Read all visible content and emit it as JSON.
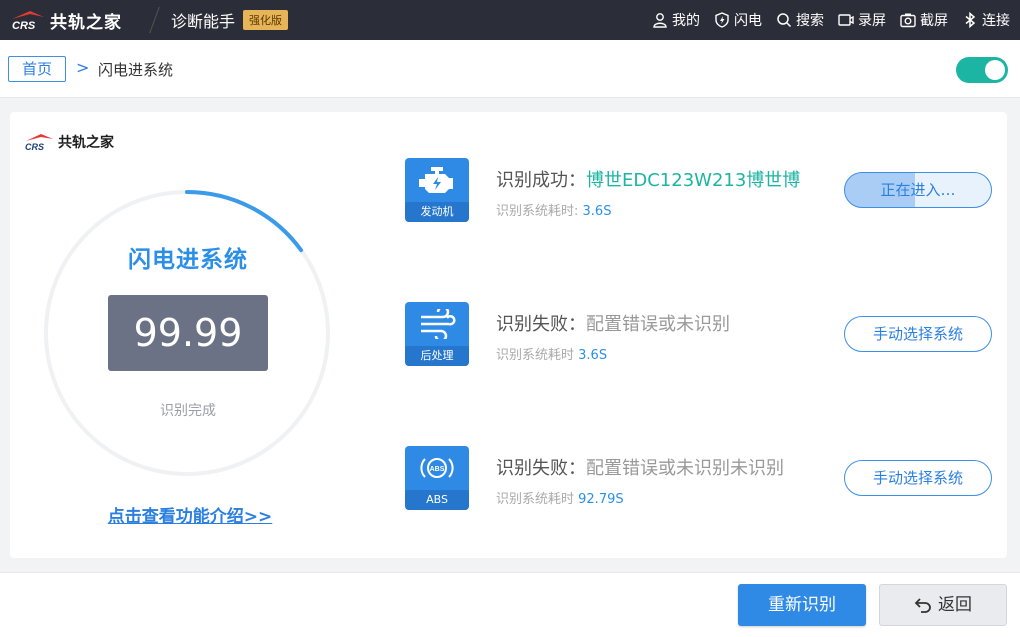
{
  "topbar": {
    "brand_text": "共轨之家",
    "app_title": "诊断能手",
    "badge": "强化版",
    "menu": [
      {
        "label": "我的",
        "icon": "user-icon"
      },
      {
        "label": "闪电",
        "icon": "flash-icon"
      },
      {
        "label": "搜索",
        "icon": "search-icon"
      },
      {
        "label": "录屏",
        "icon": "record-icon"
      },
      {
        "label": "截屏",
        "icon": "screenshot-icon"
      },
      {
        "label": "连接",
        "icon": "bluetooth-icon"
      }
    ]
  },
  "breadcrumb": {
    "home": "首页",
    "separator": ">",
    "current": "闪电进系统"
  },
  "toggle": {
    "on": true,
    "color": "#1cb5a3"
  },
  "card": {
    "logo_text": "共轨之家",
    "title": "闪电进系统",
    "value": "99.99",
    "status": "识别完成",
    "progress_arc_fraction": 0.15,
    "intro_link": "点击查看功能介绍>>"
  },
  "systems": [
    {
      "icon": "engine-icon",
      "caption": "发动机",
      "result_label": "识别成功：",
      "result_value": "博世EDC123W213博世博",
      "time_label": "识别系统耗时: ",
      "time_value": "3.6S",
      "button": "正在进入…",
      "state": "success"
    },
    {
      "icon": "aftertreatment-icon",
      "caption": "后处理",
      "result_label": "识别失败：",
      "result_value": "配置错误或未识别",
      "time_label": "识别系统耗时 ",
      "time_value": "3.6S",
      "button": "手动选择系统",
      "state": "fail"
    },
    {
      "icon": "abs-icon",
      "caption": "ABS",
      "result_label": "识别失败：",
      "result_value": "配置错误或未识别未识别",
      "time_label": "识别系统耗时 ",
      "time_value": "92.79S",
      "button": "手动选择系统",
      "state": "fail"
    }
  ],
  "footer": {
    "primary": "重新识别",
    "secondary": "返回"
  },
  "colors": {
    "accent": "#2f8ae6",
    "success": "#1cb5a3",
    "topbar": "#2b2e38"
  }
}
